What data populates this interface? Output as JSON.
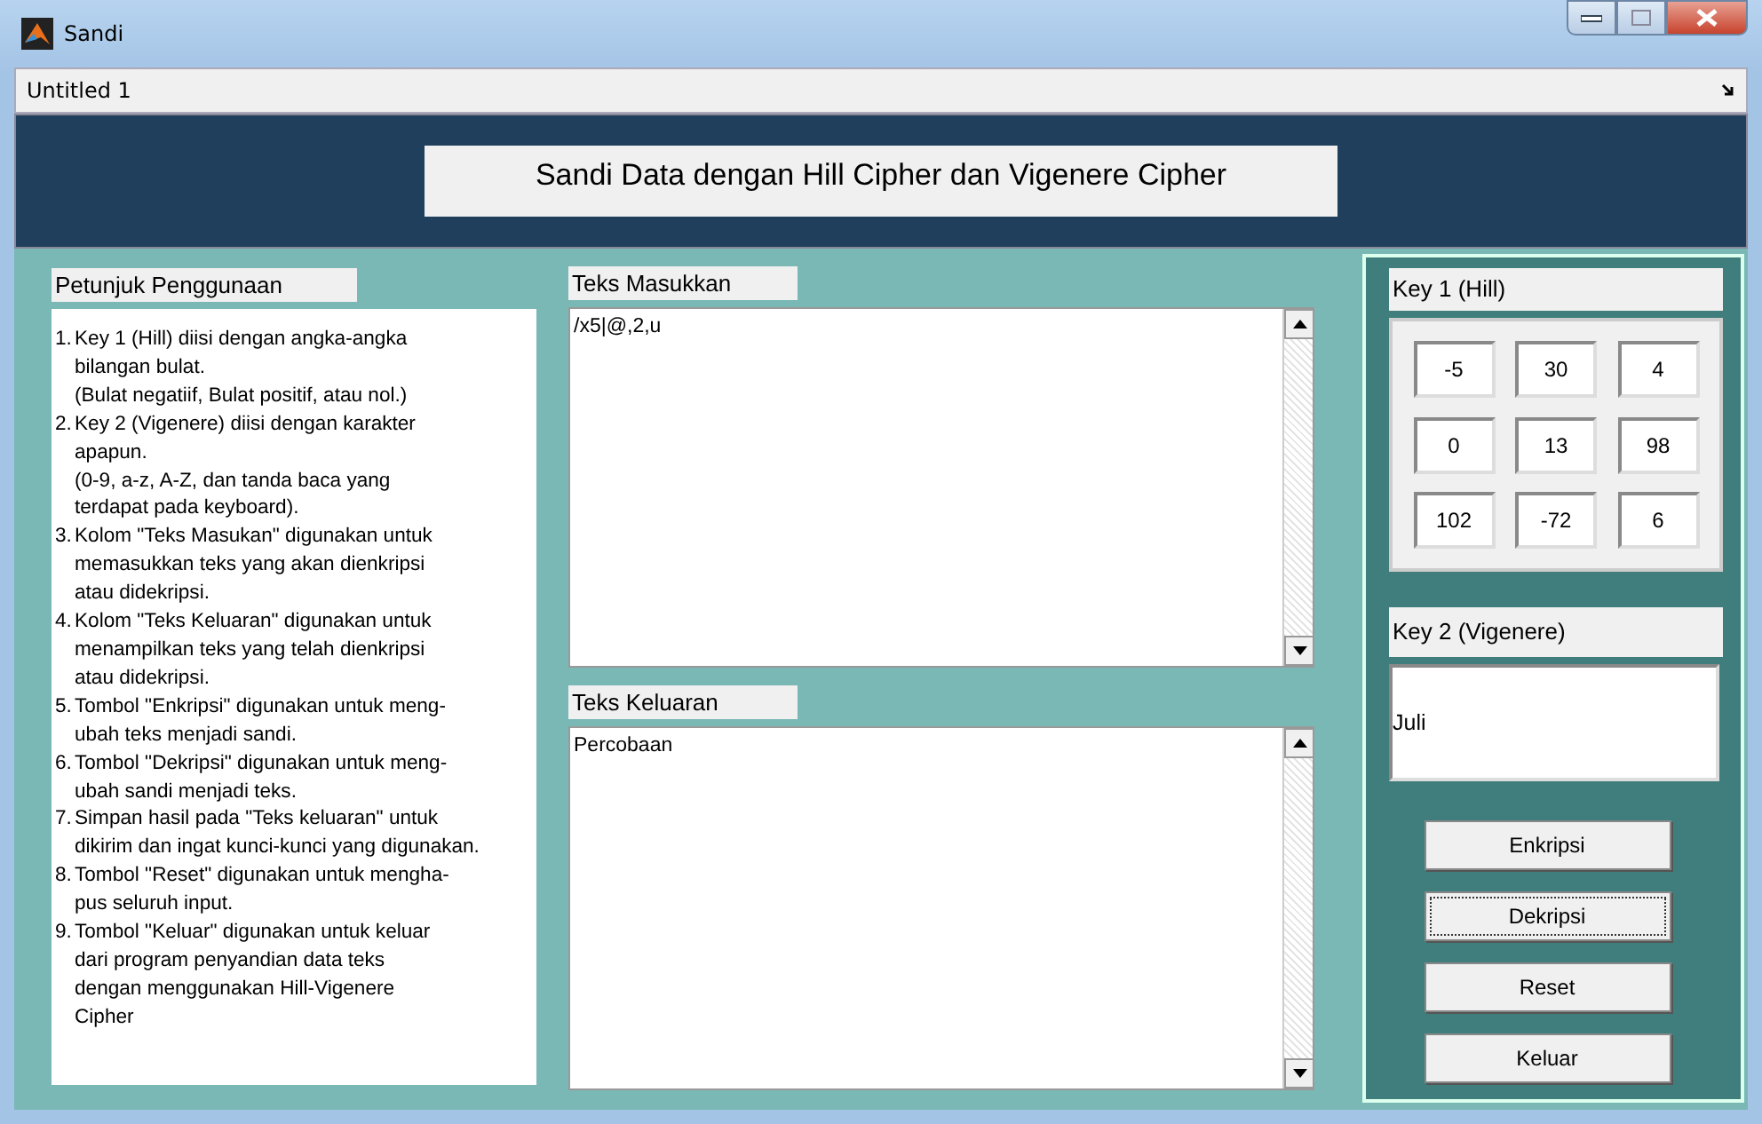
{
  "window": {
    "title": "Sandi"
  },
  "toolbar": {
    "title": "Untitled 1"
  },
  "header": {
    "title": "Sandi Data dengan Hill Cipher dan Vigenere Cipher"
  },
  "instructions": {
    "label": "Petunjuk Penggunaan",
    "items": [
      {
        "number": "1.",
        "text": "Key 1 (Hill) diisi dengan angka-angka\nbilangan bulat.\n(Bulat negatiif, Bulat positif, atau nol.)"
      },
      {
        "number": "2.",
        "text": "Key 2 (Vigenere) diisi dengan karakter\napapun.\n(0-9, a-z, A-Z, dan tanda baca yang\nterdapat pada keyboard)."
      },
      {
        "number": "3.",
        "text": "Kolom \"Teks Masukan\" digunakan untuk\nmemasukkan teks yang akan dienkripsi\natau didekripsi."
      },
      {
        "number": "4.",
        "text": "Kolom \"Teks Keluaran\" digunakan untuk\nmenampilkan teks yang telah dienkripsi\natau didekripsi."
      },
      {
        "number": "5.",
        "text": "Tombol \"Enkripsi\" digunakan untuk meng-\nubah teks menjadi sandi."
      },
      {
        "number": "6.",
        "text": "Tombol \"Dekripsi\" digunakan untuk meng-\nubah sandi menjadi teks."
      },
      {
        "number": "7.",
        "text": "Simpan hasil pada \"Teks keluaran\" untuk\ndikirim dan ingat kunci-kunci yang digunakan."
      },
      {
        "number": "8.",
        "text": "Tombol \"Reset\" digunakan untuk mengha-\npus seluruh input."
      },
      {
        "number": "9.",
        "text": "Tombol \"Keluar\" digunakan untuk keluar\ndari program penyandian data teks\ndengan menggunakan Hill-Vigenere\nCipher"
      }
    ]
  },
  "input": {
    "label": "Teks Masukkan",
    "value": "/x5|@,2,u"
  },
  "output": {
    "label": "Teks Keluaran",
    "value": "Percobaan"
  },
  "key1": {
    "label": "Key 1 (Hill)",
    "cells": [
      "-5",
      "30",
      "4",
      "0",
      "13",
      "98",
      "102",
      "-72",
      "6"
    ]
  },
  "key2": {
    "label": "Key 2 (Vigenere)",
    "value": "Juli"
  },
  "buttons": [
    {
      "label": "Enkripsi",
      "focused": false
    },
    {
      "label": "Dekripsi",
      "focused": true
    },
    {
      "label": "Reset",
      "focused": false
    },
    {
      "label": "Keluar",
      "focused": false
    }
  ]
}
